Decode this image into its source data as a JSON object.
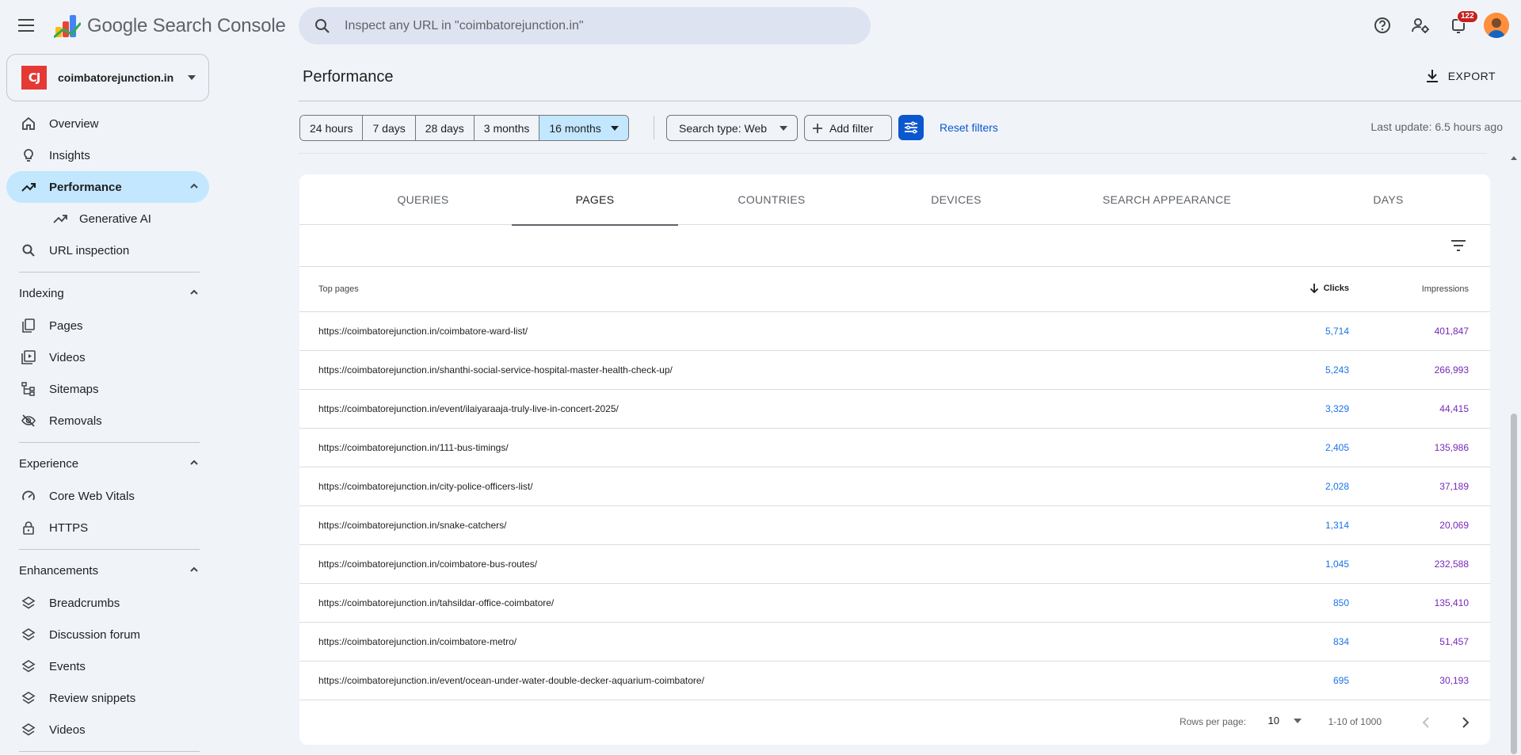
{
  "header": {
    "app_name": "Google Search Console",
    "search_placeholder": "Inspect any URL in \"coimbatorejunction.in\"",
    "notification_count": "122"
  },
  "sidebar": {
    "property": {
      "logo_text": "CJ",
      "name": "coimbatorejunction.in"
    },
    "top_items": [
      {
        "label": "Overview",
        "icon": "home-icon"
      },
      {
        "label": "Insights",
        "icon": "lightbulb-icon"
      },
      {
        "label": "Performance",
        "icon": "trending-up-icon",
        "active": true
      },
      {
        "label": "Generative AI",
        "icon": "trending-up-icon",
        "sub": true
      },
      {
        "label": "URL inspection",
        "icon": "search-icon"
      }
    ],
    "sections": [
      {
        "title": "Indexing",
        "items": [
          {
            "label": "Pages",
            "icon": "pages-icon"
          },
          {
            "label": "Videos",
            "icon": "video-icon"
          },
          {
            "label": "Sitemaps",
            "icon": "sitemap-icon"
          },
          {
            "label": "Removals",
            "icon": "eye-off-icon"
          }
        ]
      },
      {
        "title": "Experience",
        "items": [
          {
            "label": "Core Web Vitals",
            "icon": "speed-icon"
          },
          {
            "label": "HTTPS",
            "icon": "lock-icon"
          }
        ]
      },
      {
        "title": "Enhancements",
        "items": [
          {
            "label": "Breadcrumbs",
            "icon": "layers-icon"
          },
          {
            "label": "Discussion forum",
            "icon": "layers-icon"
          },
          {
            "label": "Events",
            "icon": "layers-icon"
          },
          {
            "label": "Review snippets",
            "icon": "layers-icon"
          },
          {
            "label": "Videos",
            "icon": "layers-icon"
          }
        ]
      }
    ]
  },
  "main": {
    "title": "Performance",
    "export_label": "EXPORT",
    "date_ranges": [
      "24 hours",
      "7 days",
      "28 days",
      "3 months",
      "16 months"
    ],
    "selected_range": "16 months",
    "search_type": "Search type: Web",
    "add_filter": "Add filter",
    "reset_filters": "Reset filters",
    "last_update": "Last update: 6.5 hours ago",
    "tabs": [
      "QUERIES",
      "PAGES",
      "COUNTRIES",
      "DEVICES",
      "SEARCH APPEARANCE",
      "DAYS"
    ],
    "active_tab": "PAGES",
    "table": {
      "headers": {
        "pages": "Top pages",
        "clicks": "Clicks",
        "impressions": "Impressions"
      },
      "rows": [
        {
          "url": "https://coimbatorejunction.in/coimbatore-ward-list/",
          "clicks": "5,714",
          "impressions": "401,847"
        },
        {
          "url": "https://coimbatorejunction.in/shanthi-social-service-hospital-master-health-check-up/",
          "clicks": "5,243",
          "impressions": "266,993"
        },
        {
          "url": "https://coimbatorejunction.in/event/ilaiyaraaja-truly-live-in-concert-2025/",
          "clicks": "3,329",
          "impressions": "44,415"
        },
        {
          "url": "https://coimbatorejunction.in/111-bus-timings/",
          "clicks": "2,405",
          "impressions": "135,986"
        },
        {
          "url": "https://coimbatorejunction.in/city-police-officers-list/",
          "clicks": "2,028",
          "impressions": "37,189"
        },
        {
          "url": "https://coimbatorejunction.in/snake-catchers/",
          "clicks": "1,314",
          "impressions": "20,069"
        },
        {
          "url": "https://coimbatorejunction.in/coimbatore-bus-routes/",
          "clicks": "1,045",
          "impressions": "232,588"
        },
        {
          "url": "https://coimbatorejunction.in/tahsildar-office-coimbatore/",
          "clicks": "850",
          "impressions": "135,410"
        },
        {
          "url": "https://coimbatorejunction.in/coimbatore-metro/",
          "clicks": "834",
          "impressions": "51,457"
        },
        {
          "url": "https://coimbatorejunction.in/event/ocean-under-water-double-decker-aquarium-coimbatore/",
          "clicks": "695",
          "impressions": "30,193"
        }
      ]
    },
    "pagination": {
      "rows_per_page_label": "Rows per page:",
      "rows_per_page": "10",
      "range": "1-10 of 1000"
    }
  },
  "colors": {
    "background": "#f0f4f9",
    "active_nav": "#c2e7ff",
    "accent_blue": "#0b57d0",
    "clicks_color": "#1a73e8",
    "impressions_color": "#7627bb"
  }
}
